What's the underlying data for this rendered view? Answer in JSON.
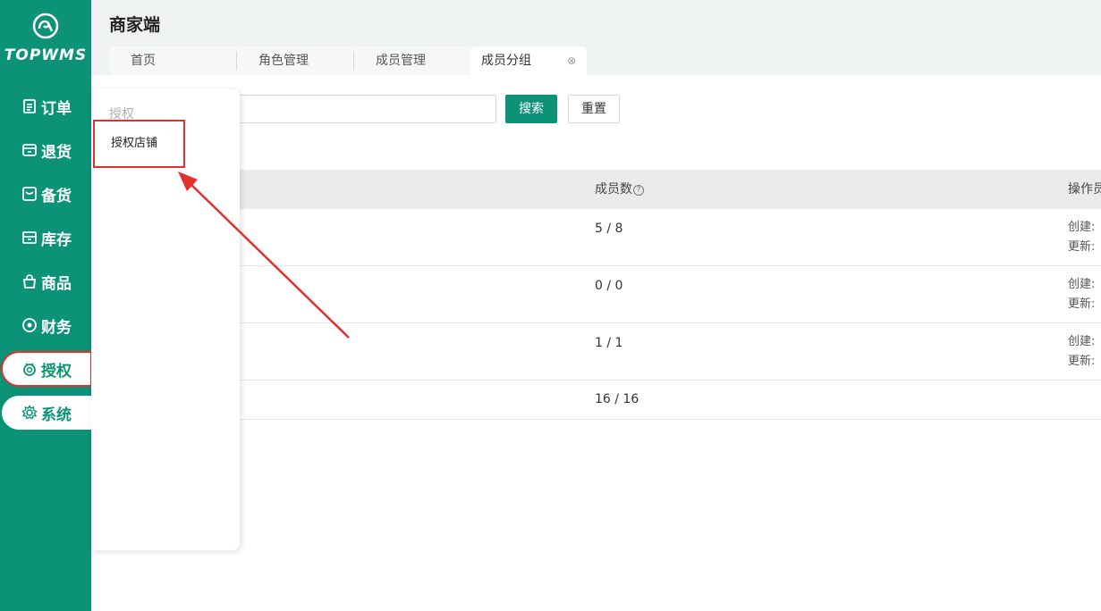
{
  "app": {
    "logo_text": "TOPWMS",
    "header_title": "商家端",
    "brand_color": "#0b9277",
    "highlight_color": "#e3302c"
  },
  "sidebar": {
    "items": [
      {
        "label": "订单",
        "icon": "file-list-icon"
      },
      {
        "label": "退货",
        "icon": "return-box-icon"
      },
      {
        "label": "备货",
        "icon": "inbox-icon"
      },
      {
        "label": "库存",
        "icon": "warehouse-icon"
      },
      {
        "label": "商品",
        "icon": "shopping-bag-icon"
      },
      {
        "label": "财务",
        "icon": "finance-icon"
      },
      {
        "label": "授权",
        "icon": "authorization-icon"
      },
      {
        "label": "系统",
        "icon": "gear-icon"
      }
    ]
  },
  "tabs": [
    {
      "label": "首页"
    },
    {
      "label": "角色管理"
    },
    {
      "label": "成员管理"
    },
    {
      "label": "成员分组",
      "active": true,
      "close": "⊗"
    }
  ],
  "toolbar": {
    "search_label": "搜索",
    "reset_label": "重置"
  },
  "flyout": {
    "title": "授权",
    "items": [
      {
        "label": "授权店铺"
      }
    ]
  },
  "table": {
    "columns": [
      "成员数",
      "操作员"
    ],
    "help_glyph": "?",
    "rows": [
      {
        "count": "5 / 8",
        "created": "创建:",
        "updated": "更新:"
      },
      {
        "count": "0 / 0",
        "created": "创建:",
        "updated": "更新:"
      },
      {
        "count": "1 / 1",
        "created": "创建:",
        "updated": "更新:"
      },
      {
        "count": "16 / 16",
        "created": "",
        "updated": ""
      }
    ]
  }
}
